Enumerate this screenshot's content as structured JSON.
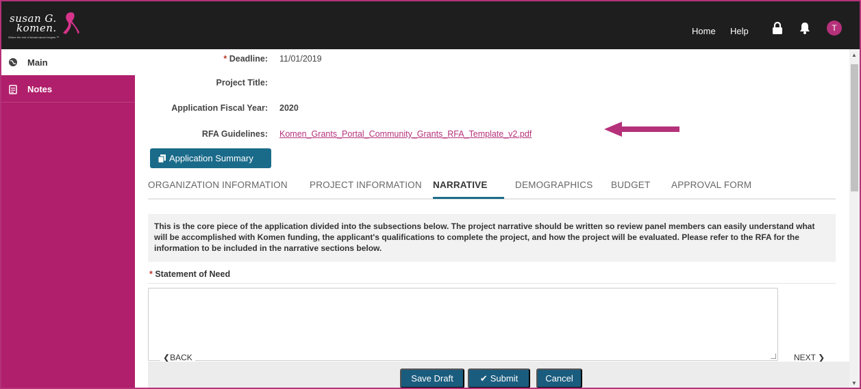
{
  "brand": {
    "logo_line1": "susan G.",
    "logo_line2": "komen.",
    "tagline": "Where the end of breast cancer begins.™",
    "accent_color": "#b5317a",
    "sidebar_color": "#b01f6b",
    "button_color": "#1a5c7e"
  },
  "topbar": {
    "home": "Home",
    "help": "Help",
    "lock_icon": "lock-icon",
    "bell_icon": "bell-icon",
    "avatar_initial": "T"
  },
  "sidebar": {
    "items": [
      {
        "label": "Main",
        "icon": "globe-icon"
      },
      {
        "label": "Notes",
        "icon": "document-icon"
      }
    ]
  },
  "fields": {
    "deadline_label": "Deadline:",
    "deadline_value": "11/01/2019",
    "project_title_label": "Project Title:",
    "fiscal_year_label": "Application Fiscal Year:",
    "fiscal_year_value": "2020",
    "rfa_label": "RFA Guidelines:",
    "rfa_link": "Komen_Grants_Portal_Community_Grants_RFA_Template_v2.pdf"
  },
  "app_summary_label": "Application Summary",
  "tabs": [
    "ORGANIZATION INFORMATION",
    "PROJECT INFORMATION",
    "NARRATIVE",
    "DEMOGRAPHICS",
    "BUDGET",
    "APPROVAL FORM"
  ],
  "intro_text": "This is the core piece of the application divided into the subsections below. The project narrative should be written so review panel members can easily understand what will be accomplished with Komen funding, the applicant's qualifications to complete the project, and how the project will be evaluated. Please refer to the RFA for the information to be included in the narrative sections below.",
  "statement_of_need_label": "Statement of Need",
  "pager": {
    "back": "BACK",
    "next": "NEXT"
  },
  "actions": {
    "save_draft": "Save Draft",
    "submit": "Submit",
    "cancel": "Cancel"
  }
}
